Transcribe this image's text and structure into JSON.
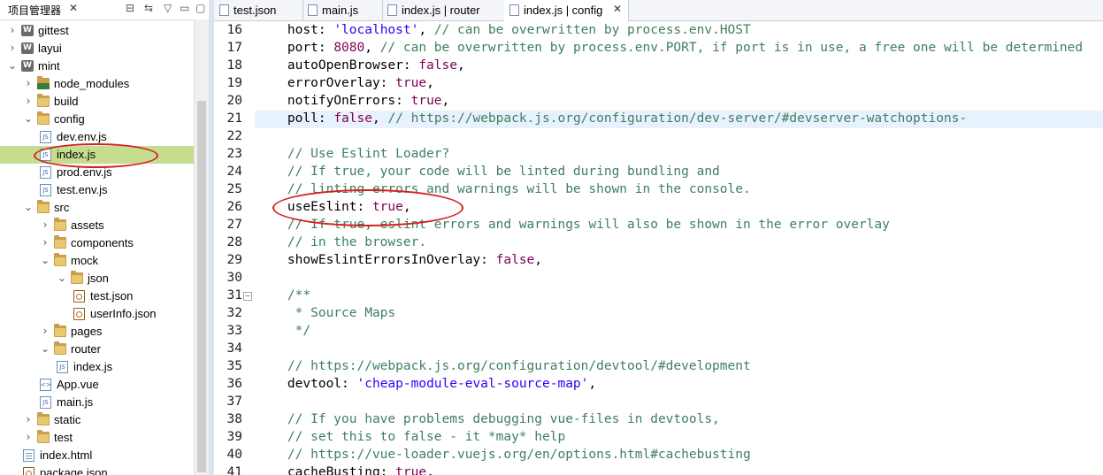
{
  "explorer": {
    "title": "项目管理器",
    "close_glyph": "✕",
    "tree": [
      {
        "label": "gittest",
        "depth": 0,
        "twisty": "collapsed",
        "icon": "project-icon"
      },
      {
        "label": "layui",
        "depth": 0,
        "twisty": "collapsed",
        "icon": "project-icon"
      },
      {
        "label": "mint",
        "depth": 0,
        "twisty": "expanded",
        "icon": "project-icon"
      },
      {
        "label": "node_modules",
        "depth": 1,
        "twisty": "collapsed",
        "icon": "library-folder-icon"
      },
      {
        "label": "build",
        "depth": 1,
        "twisty": "collapsed",
        "icon": "folder-icon"
      },
      {
        "label": "config",
        "depth": 1,
        "twisty": "expanded",
        "icon": "folder-icon"
      },
      {
        "label": "dev.env.js",
        "depth": 2,
        "twisty": "none",
        "icon": "js-file-icon"
      },
      {
        "label": "index.js",
        "depth": 2,
        "twisty": "none",
        "icon": "js-file-icon",
        "selected": true
      },
      {
        "label": "prod.env.js",
        "depth": 2,
        "twisty": "none",
        "icon": "js-file-icon"
      },
      {
        "label": "test.env.js",
        "depth": 2,
        "twisty": "none",
        "icon": "js-file-icon"
      },
      {
        "label": "src",
        "depth": 1,
        "twisty": "expanded",
        "icon": "folder-icon"
      },
      {
        "label": "assets",
        "depth": 2,
        "twisty": "collapsed",
        "icon": "folder-icon"
      },
      {
        "label": "components",
        "depth": 2,
        "twisty": "collapsed",
        "icon": "folder-icon"
      },
      {
        "label": "mock",
        "depth": 2,
        "twisty": "expanded",
        "icon": "folder-icon"
      },
      {
        "label": "json",
        "depth": 3,
        "twisty": "expanded",
        "icon": "folder-icon"
      },
      {
        "label": "test.json",
        "depth": 4,
        "twisty": "none",
        "icon": "json-file-icon"
      },
      {
        "label": "userInfo.json",
        "depth": 4,
        "twisty": "none",
        "icon": "json-file-icon"
      },
      {
        "label": "pages",
        "depth": 2,
        "twisty": "collapsed",
        "icon": "folder-icon"
      },
      {
        "label": "router",
        "depth": 2,
        "twisty": "expanded",
        "icon": "folder-icon"
      },
      {
        "label": "index.js",
        "depth": 3,
        "twisty": "none",
        "icon": "js-file-icon"
      },
      {
        "label": "App.vue",
        "depth": 2,
        "twisty": "none",
        "icon": "vue-file-icon"
      },
      {
        "label": "main.js",
        "depth": 2,
        "twisty": "none",
        "icon": "js-file-icon"
      },
      {
        "label": "static",
        "depth": 1,
        "twisty": "collapsed",
        "icon": "folder-icon"
      },
      {
        "label": "test",
        "depth": 1,
        "twisty": "collapsed",
        "icon": "folder-icon"
      },
      {
        "label": "index.html",
        "depth": 1,
        "twisty": "none",
        "icon": "html-file-icon"
      },
      {
        "label": "package.json",
        "depth": 1,
        "twisty": "none",
        "icon": "json-file-icon"
      }
    ]
  },
  "tabs": [
    {
      "label": "test.json",
      "icon": "json-file-icon"
    },
    {
      "label": "main.js",
      "icon": "js-file-icon"
    },
    {
      "label": "index.js | router",
      "icon": "js-file-icon"
    },
    {
      "label": "index.js | config",
      "icon": "js-file-icon",
      "active": true,
      "close_glyph": "✕"
    }
  ],
  "editor": {
    "highlight_line": 21,
    "lines": [
      {
        "n": "16",
        "tokens": [
          [
            "    host: ",
            "key"
          ],
          [
            "'localhost'",
            "str"
          ],
          [
            ", ",
            "key"
          ],
          [
            "// can be overwritten by process.env.HOST",
            "cm"
          ]
        ]
      },
      {
        "n": "17",
        "tokens": [
          [
            "    port: ",
            "key"
          ],
          [
            "8080",
            "num"
          ],
          [
            ", ",
            "key"
          ],
          [
            "// can be overwritten by process.env.PORT, if port is in use, a free one will be determined",
            "cm"
          ]
        ]
      },
      {
        "n": "18",
        "tokens": [
          [
            "    autoOpenBrowser: ",
            "key"
          ],
          [
            "false",
            "kw"
          ],
          [
            ",",
            "key"
          ]
        ]
      },
      {
        "n": "19",
        "tokens": [
          [
            "    errorOverlay: ",
            "key"
          ],
          [
            "true",
            "kw"
          ],
          [
            ",",
            "key"
          ]
        ]
      },
      {
        "n": "20",
        "tokens": [
          [
            "    notifyOnErrors: ",
            "key"
          ],
          [
            "true",
            "kw"
          ],
          [
            ",",
            "key"
          ]
        ]
      },
      {
        "n": "21",
        "tokens": [
          [
            "    poll: ",
            "key"
          ],
          [
            "false",
            "kw"
          ],
          [
            ", ",
            "key"
          ],
          [
            "// https://webpack.js.org/configuration/dev-server/#devserver-watchoptions-",
            "cm"
          ]
        ]
      },
      {
        "n": "22",
        "tokens": []
      },
      {
        "n": "23",
        "tokens": [
          [
            "    // Use Eslint Loader?",
            "cm"
          ]
        ]
      },
      {
        "n": "24",
        "tokens": [
          [
            "    // If true, your code will be linted during bundling and",
            "cm"
          ]
        ]
      },
      {
        "n": "25",
        "tokens": [
          [
            "    // linting errors and warnings will be shown in the console.",
            "cm"
          ]
        ]
      },
      {
        "n": "26",
        "tokens": [
          [
            "    useEslint: ",
            "key"
          ],
          [
            "true",
            "kw"
          ],
          [
            ",",
            "key"
          ]
        ]
      },
      {
        "n": "27",
        "tokens": [
          [
            "    // If true, eslint errors and warnings will also be shown in the error overlay",
            "cm"
          ]
        ]
      },
      {
        "n": "28",
        "tokens": [
          [
            "    // in the browser.",
            "cm"
          ]
        ]
      },
      {
        "n": "29",
        "tokens": [
          [
            "    showEslintErrorsInOverlay: ",
            "key"
          ],
          [
            "false",
            "kw"
          ],
          [
            ",",
            "key"
          ]
        ]
      },
      {
        "n": "30",
        "tokens": []
      },
      {
        "n": "31",
        "tokens": [
          [
            "    /**",
            "cm"
          ]
        ]
      },
      {
        "n": "32",
        "tokens": [
          [
            "     * Source Maps",
            "cm"
          ]
        ]
      },
      {
        "n": "33",
        "tokens": [
          [
            "     */",
            "cm"
          ]
        ]
      },
      {
        "n": "34",
        "tokens": []
      },
      {
        "n": "35",
        "tokens": [
          [
            "    // https://webpack.js.org/configuration/devtool/#development",
            "cm"
          ]
        ]
      },
      {
        "n": "36",
        "tokens": [
          [
            "    devtool: ",
            "key"
          ],
          [
            "'cheap-module-eval-source-map'",
            "str"
          ],
          [
            ",",
            "key"
          ]
        ]
      },
      {
        "n": "37",
        "tokens": []
      },
      {
        "n": "38",
        "tokens": [
          [
            "    // If you have problems debugging vue-files in devtools,",
            "cm"
          ]
        ]
      },
      {
        "n": "39",
        "tokens": [
          [
            "    // set this to false - it *may* help",
            "cm"
          ]
        ]
      },
      {
        "n": "40",
        "tokens": [
          [
            "    // https://vue-loader.vuejs.org/en/options.html#cachebusting",
            "cm"
          ]
        ]
      },
      {
        "n": "41",
        "tokens": [
          [
            "    cacheBusting: ",
            "key"
          ],
          [
            "true",
            "kw"
          ],
          [
            ",",
            "key"
          ]
        ]
      }
    ]
  },
  "colors": {
    "selected_row": "#c6dd90",
    "current_line": "#e8f2fe",
    "annotation_red": "#d42020",
    "comment": "#3f7f5f",
    "keyword": "#7f0055",
    "string": "#2a00ff"
  }
}
